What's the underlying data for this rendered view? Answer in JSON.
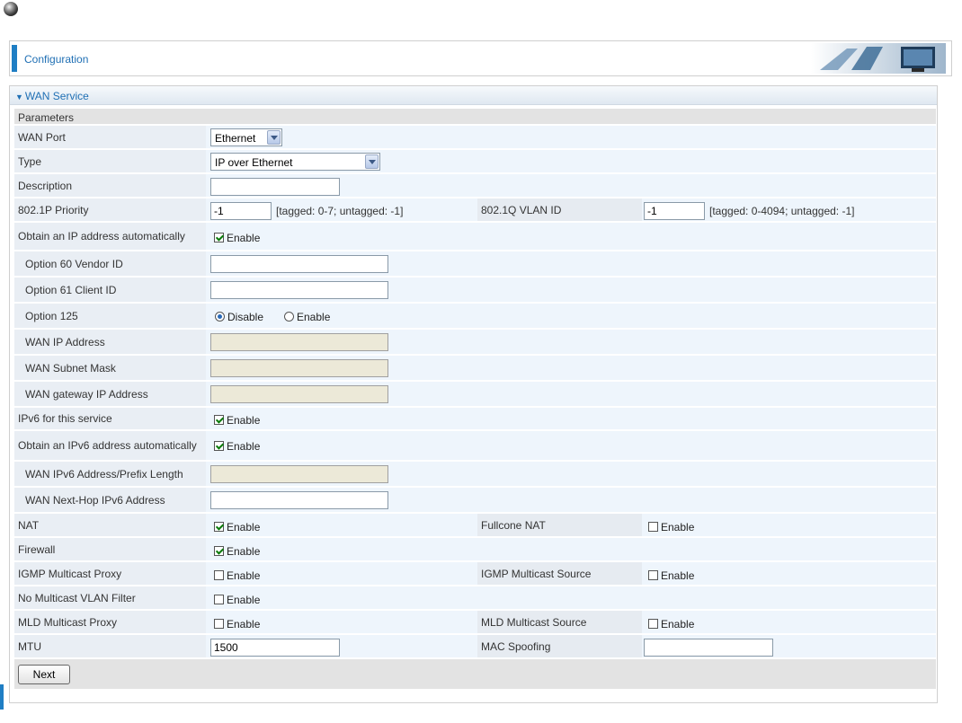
{
  "header": {
    "title": "Configuration"
  },
  "panel": {
    "title": "WAN Service",
    "section": "Parameters"
  },
  "fields": {
    "wan_port": {
      "label": "WAN Port",
      "value": "Ethernet"
    },
    "type": {
      "label": "Type",
      "value": "IP over Ethernet"
    },
    "description": {
      "label": "Description",
      "value": ""
    },
    "priority": {
      "label": "802.1P Priority",
      "value": "-1",
      "hint": "[tagged: 0-7; untagged: -1]"
    },
    "vlan_id": {
      "label": "802.1Q VLAN ID",
      "value": "-1",
      "hint": "[tagged: 0-4094; untagged: -1]"
    },
    "obtain_ip": {
      "label": "Obtain an IP address automatically",
      "option": "Enable",
      "checked": true
    },
    "option60": {
      "label": "Option 60 Vendor ID",
      "value": ""
    },
    "option61": {
      "label": "Option 61 Client ID",
      "value": ""
    },
    "option125": {
      "label": "Option 125",
      "disable_label": "Disable",
      "enable_label": "Enable",
      "selected": "Disable"
    },
    "wan_ip": {
      "label": "WAN IP Address",
      "value": ""
    },
    "wan_mask": {
      "label": "WAN Subnet Mask",
      "value": ""
    },
    "wan_gateway": {
      "label": "WAN gateway IP Address",
      "value": ""
    },
    "ipv6_service": {
      "label": "IPv6 for this service",
      "option": "Enable",
      "checked": true
    },
    "obtain_ipv6": {
      "label": "Obtain an IPv6 address automatically",
      "option": "Enable",
      "checked": true
    },
    "wan_ipv6_prefix": {
      "label": "WAN IPv6 Address/Prefix Length",
      "value": ""
    },
    "wan_nexthop_ipv6": {
      "label": "WAN Next-Hop IPv6 Address",
      "value": ""
    },
    "nat": {
      "label": "NAT",
      "option": "Enable",
      "checked": true
    },
    "fullcone_nat": {
      "label": "Fullcone NAT",
      "option": "Enable",
      "checked": false
    },
    "firewall": {
      "label": "Firewall",
      "option": "Enable",
      "checked": true
    },
    "igmp_proxy": {
      "label": "IGMP Multicast Proxy",
      "option": "Enable",
      "checked": false
    },
    "igmp_source": {
      "label": "IGMP Multicast Source",
      "option": "Enable",
      "checked": false
    },
    "no_mcast_vlan": {
      "label": "No Multicast VLAN Filter",
      "option": "Enable",
      "checked": false
    },
    "mld_proxy": {
      "label": "MLD Multicast Proxy",
      "option": "Enable",
      "checked": false
    },
    "mld_source": {
      "label": "MLD Multicast Source",
      "option": "Enable",
      "checked": false
    },
    "mtu": {
      "label": "MTU",
      "value": "1500"
    },
    "mac_spoofing": {
      "label": "MAC Spoofing",
      "value": ""
    }
  },
  "buttons": {
    "next": "Next"
  }
}
